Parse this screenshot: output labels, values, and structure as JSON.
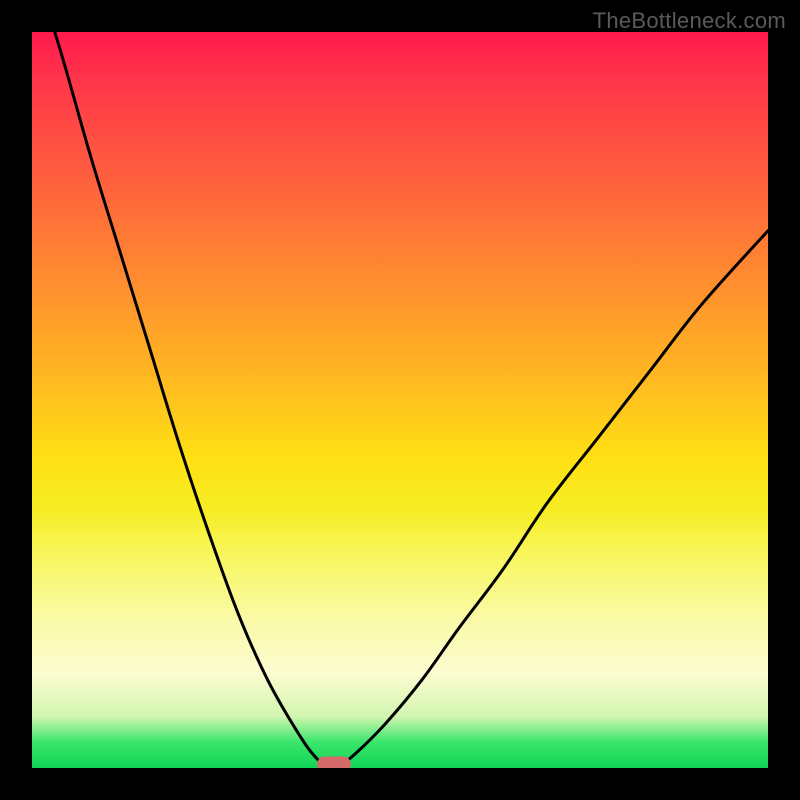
{
  "watermark": "TheBottleneck.com",
  "chart_data": {
    "type": "line",
    "title": "",
    "xlabel": "",
    "ylabel": "",
    "xlim": [
      0,
      1
    ],
    "ylim": [
      0,
      1
    ],
    "description": "V-shaped bottleneck curve over vertical rainbow gradient (red at top through orange/yellow to green at bottom). Curve descends steeply from upper-left, reaches a minimum near x≈0.41 at the bottom edge, then rises less steeply toward the right edge reaching roughly y≈0.73.",
    "series": [
      {
        "name": "bottleneck-curve",
        "x": [
          0.0,
          0.04,
          0.08,
          0.12,
          0.16,
          0.2,
          0.24,
          0.28,
          0.32,
          0.36,
          0.385,
          0.405,
          0.42,
          0.44,
          0.48,
          0.53,
          0.58,
          0.64,
          0.7,
          0.77,
          0.84,
          0.91,
          1.0
        ],
        "y": [
          1.1,
          0.97,
          0.83,
          0.7,
          0.57,
          0.44,
          0.32,
          0.21,
          0.12,
          0.05,
          0.015,
          0.0,
          0.005,
          0.02,
          0.06,
          0.12,
          0.19,
          0.27,
          0.36,
          0.45,
          0.54,
          0.63,
          0.73
        ]
      }
    ],
    "marker": {
      "x": 0.41,
      "y": 0.005
    },
    "gradient_stops": [
      {
        "pos": 0.0,
        "color": "#ff1a4d"
      },
      {
        "pos": 0.33,
        "color": "#ff8a30"
      },
      {
        "pos": 0.58,
        "color": "#ffe014"
      },
      {
        "pos": 0.87,
        "color": "#fcfcd0"
      },
      {
        "pos": 1.0,
        "color": "#12d456"
      }
    ]
  }
}
